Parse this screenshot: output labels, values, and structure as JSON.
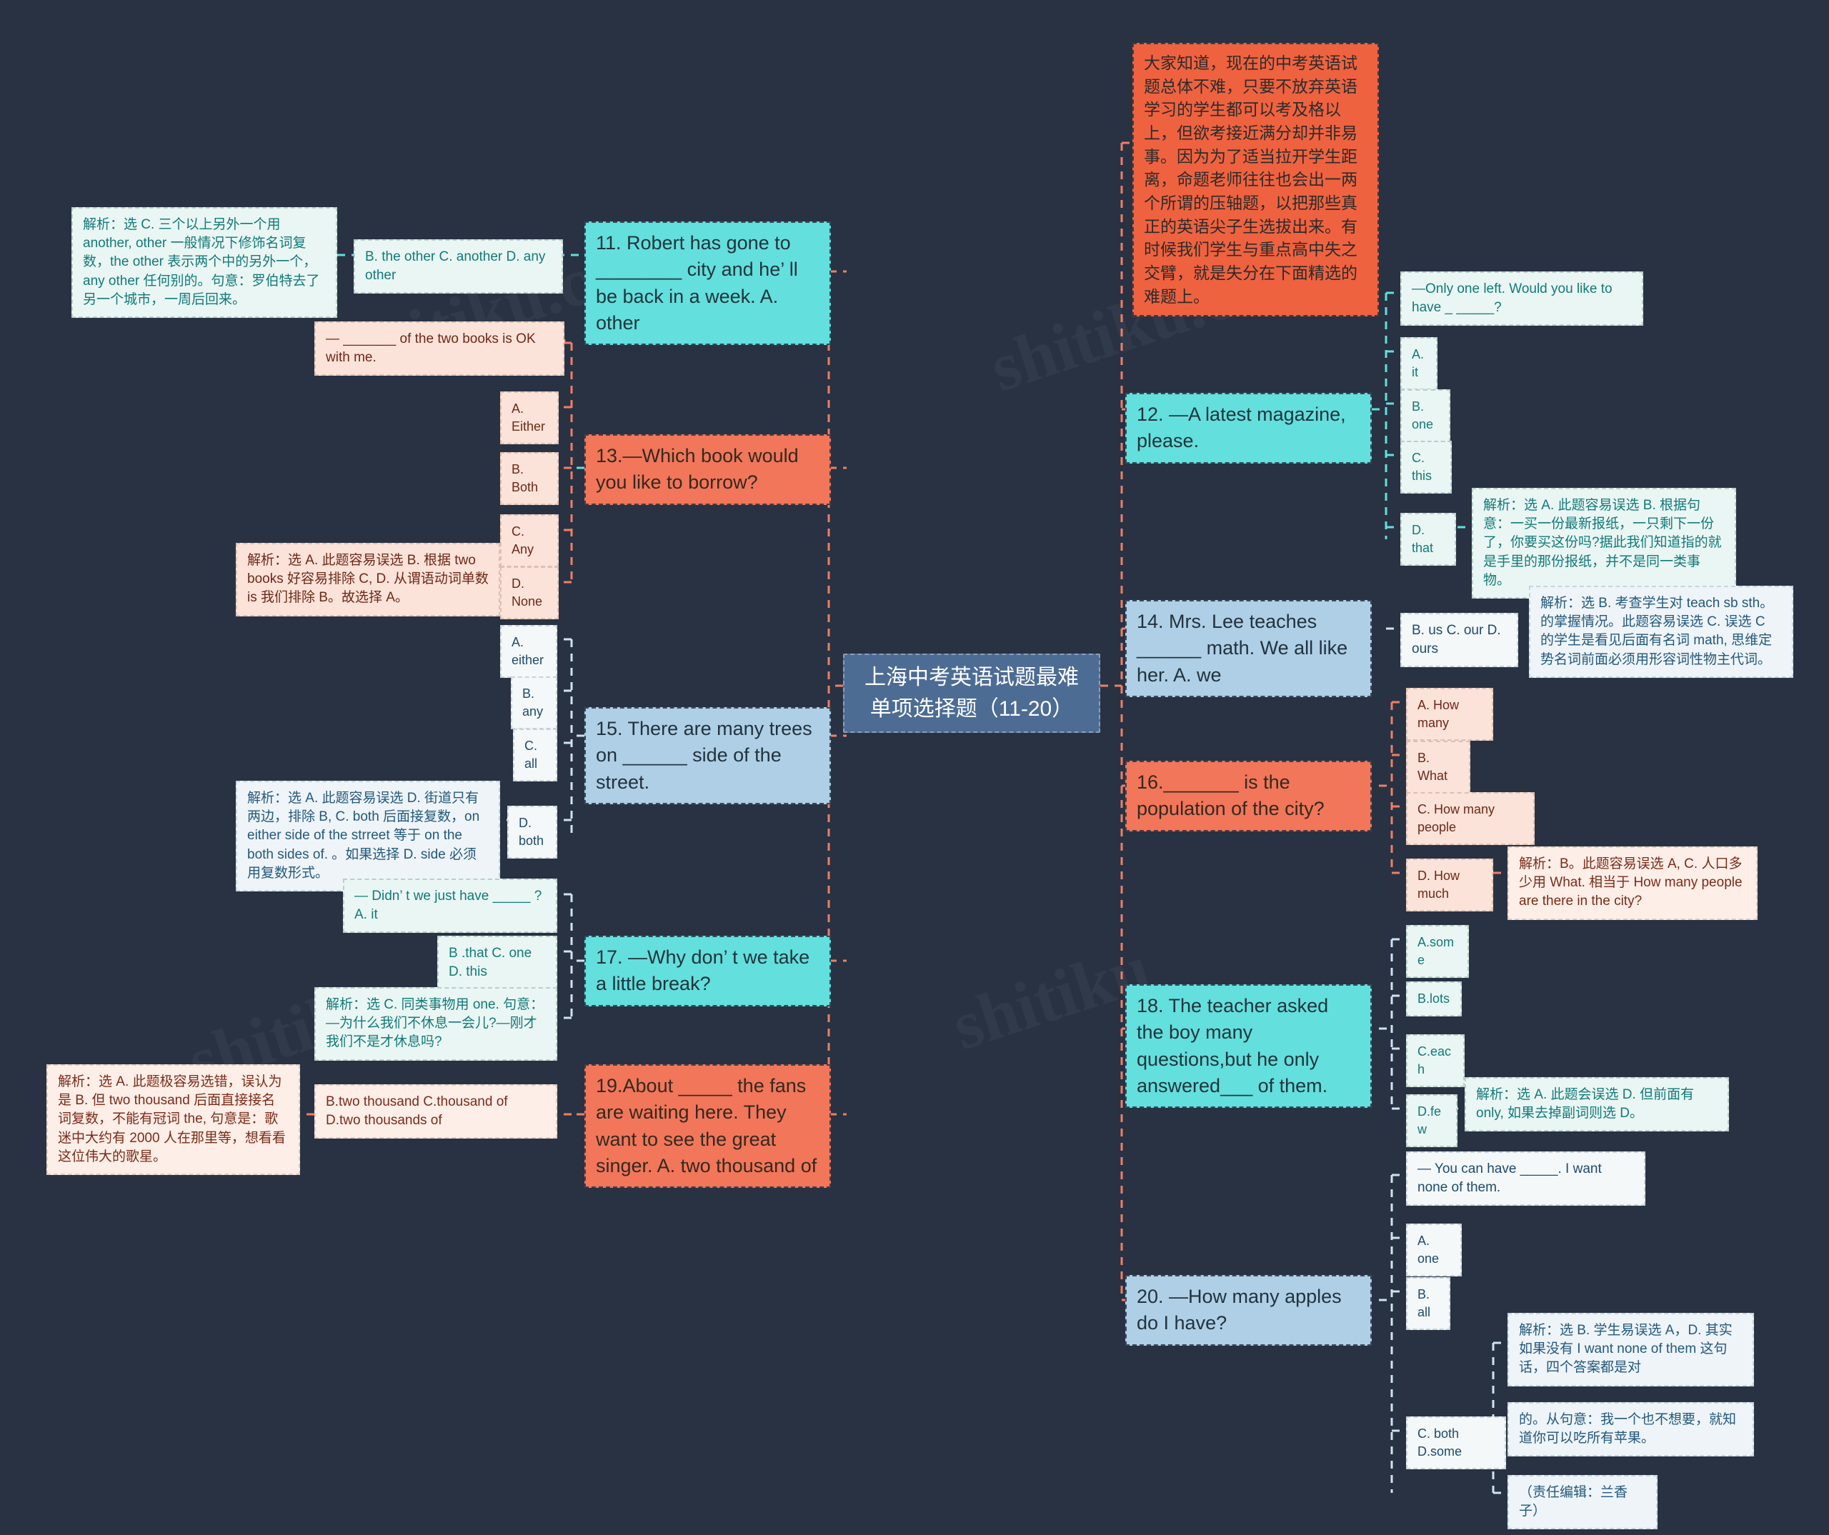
{
  "page": {
    "background_color": "#283243",
    "title_node": "上海中考英语试题最难单项选择题（11-20）"
  },
  "palette": {
    "center": "#4d6c94",
    "orange": "#ef623f",
    "orange_alt": "#f2765a",
    "cyan": "#63dfdd",
    "blue": "#aecfe5",
    "mint": "#eaf6f3",
    "peach": "#fbe3d9",
    "white": "#f4f8f9"
  },
  "watermarks": [
    "www.shitiku.cn",
    "shitiku.cn",
    "www.shitiku.cn",
    "shitiku"
  ],
  "intro": {
    "text": "大家知道，现在的中考英语试题总体不难，只要不放弃英语学习的学生都可以考及格以上，但欲考接近满分却并非易事。因为为了适当拉开学生距离，命题老师往往也会出一两个所谓的压轴题，以把那些真正的英语尖子生选拔出来。有时候我们学生与重点高中失之交臂，就是失分在下面精选的难题上。"
  },
  "left_branches": [
    {
      "id": "q11",
      "question": "11. Robert has gone to ________ city and he’ ll be back in a week. A. other",
      "options": "B. the other C. another D. any other",
      "explanation": "解析：选 C. 三个以上另外一个用 another, other 一般情况下修饰名词复数，the other 表示两个中的另外一个，any other 任何别的。句意：罗伯特去了另一个城市，一周后回来。"
    },
    {
      "id": "q13",
      "question": "13.—Which book would you like to borrow?",
      "stem": "— _______ of the two books is OK with me.",
      "options": [
        "A. Either",
        "B. Both",
        "C. Any",
        "D. None"
      ],
      "explanation": "解析：选 A. 此题容易误选 B. 根据 two books 好容易排除 C, D. 从谓语动词单数 is 我们排除 B。故选择 A。"
    },
    {
      "id": "q15",
      "question": "15. There are many trees on ______ side of the street.",
      "options": [
        "A. either",
        "B. any",
        "C. all",
        "D. both"
      ],
      "explanation": "解析：选 A. 此题容易误选 D. 街道只有两边，排除 B, C. both 后面接复数，on either side of the strreet 等于 on the both sides of. 。如果选择 D. side 必须用复数形式。"
    },
    {
      "id": "q17",
      "question": "17. —Why don’ t we take a little break?",
      "stem": "— Didn’ t we just have _____ ? A. it",
      "options": "B .that C. one D. this",
      "explanation": "解析：选 C. 同类事物用 one. 句意：—为什么我们不休息一会儿?—刚才我们不是才休息吗?"
    },
    {
      "id": "q19",
      "question": "19.About _____ the fans are waiting here. They want to see the great singer. A. two thousand of",
      "options": "B.two thousand C.thousand of D.two thousands of",
      "explanation": "解析：选 A. 此题极容易选错，误认为是 B. 但 two thousand 后面直接接名词复数，不能有冠词 the, 句意是：歌迷中大约有 2000 人在那里等，想看看这位伟大的歌星。"
    }
  ],
  "right_branches": [
    {
      "id": "q12",
      "question": "12. —A latest magazine, please.",
      "stem": "—Only one left. Would you like to have _ _____?",
      "options": [
        "A. it",
        "B. one",
        "C. this",
        "D. that"
      ],
      "explanation": "解析：选 A. 此题容易误选 B. 根据句意：一买一份最新报纸，一只剩下一份了，你要买这份吗?据此我们知道指的就是手里的那份报纸，并不是同一类事物。"
    },
    {
      "id": "q14",
      "question": "14. Mrs. Lee teaches ______ math. We all like her. A. we",
      "options": "B. us C. our D. ours",
      "explanation": "解析：选 B. 考查学生对 teach sb sth。的掌握情况。此题容易误选 C. 误选 C 的学生是看见后面有名词 math, 思维定势名词前面必须用形容词性物主代词。"
    },
    {
      "id": "q16",
      "question": "16._______ is the population of the city?",
      "options": [
        "A. How many",
        "B. What",
        "C. How many people",
        "D. How much"
      ],
      "explanation": "解析：B。此题容易误选 A, C. 人口多少用 What. 相当于 How many people are there in the city?"
    },
    {
      "id": "q18",
      "question": "18. The teacher asked the boy many questions,but he only answered___ of them.",
      "options": [
        "A.some",
        "B.lots",
        "C.each",
        "D.few"
      ],
      "explanation": "解析：选 A. 此题会误选 D. 但前面有 only, 如果去掉副词则选 D。"
    },
    {
      "id": "q20",
      "question": "20. —How many apples do I have?",
      "stem": "— You can have _____. I want none of them.",
      "options": [
        "A. one",
        "B. all",
        "C. both D.some"
      ],
      "explanation_1": "解析：选 B. 学生易误选 A，D. 其实如果没有 I want none of them 这句话，四个答案都是对",
      "explanation_2": "的。从句意：我一个也不想要，就知道你可以吃所有苹果。",
      "editor": "（责任编辑：兰香子）"
    }
  ]
}
